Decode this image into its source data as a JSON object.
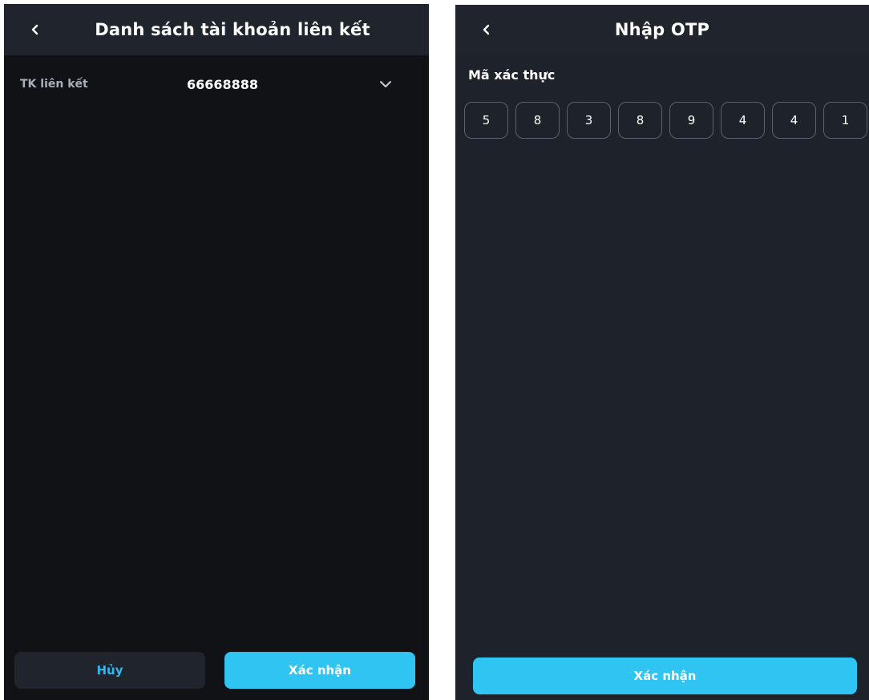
{
  "left": {
    "header": {
      "title": "Danh sách tài khoản liên kết"
    },
    "account": {
      "label": "TK liên kết",
      "value": "66668888"
    },
    "buttons": {
      "cancel": "Hủy",
      "confirm": "Xác nhận"
    }
  },
  "right": {
    "header": {
      "title": "Nhập OTP"
    },
    "otp": {
      "label": "Mã xác thực",
      "digits": [
        "5",
        "8",
        "3",
        "8",
        "9",
        "4",
        "4",
        "1"
      ]
    },
    "buttons": {
      "confirm": "Xác nhận"
    }
  },
  "colors": {
    "accent": "#2fc4f2",
    "left_background": "#111216",
    "right_background": "#1e222b",
    "header_background": "#1f242d"
  },
  "icons": [
    "back-icon",
    "chevron-down-icon"
  ]
}
